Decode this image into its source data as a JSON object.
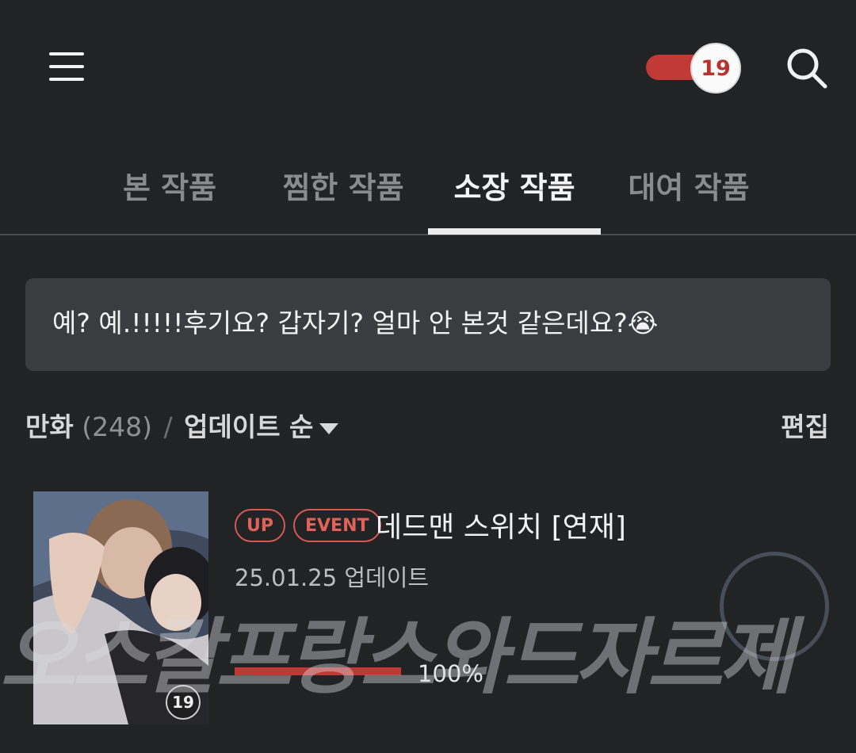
{
  "header": {
    "menu_icon": "hamburger-menu-icon",
    "adult_toggle_label": "19",
    "search_icon": "search-icon",
    "accent_color": "#c23a35"
  },
  "tabs": [
    {
      "label": "본 작품",
      "active": false
    },
    {
      "label": "찜한 작품",
      "active": false
    },
    {
      "label": "소장 작품",
      "active": true
    },
    {
      "label": "대여 작품",
      "active": false
    }
  ],
  "notice": {
    "text": "예? 예.!!!!!후기요? 갑자기? 얼마 안 본것 같은데요?😭"
  },
  "list_header": {
    "category": "만화",
    "count": "(248)",
    "separator": "/",
    "sort_label": "업데이트 순",
    "edit_label": "편집"
  },
  "items": [
    {
      "badges": [
        "UP",
        "EVENT"
      ],
      "title": "데드맨 스위치 [연재]",
      "date": "25.01.25 업데이트",
      "age_rating": "19",
      "progress_label": "100%",
      "progress_fraction": 1.0
    }
  ],
  "watermark": {
    "text": "오스칼프랑스와드자르제"
  }
}
